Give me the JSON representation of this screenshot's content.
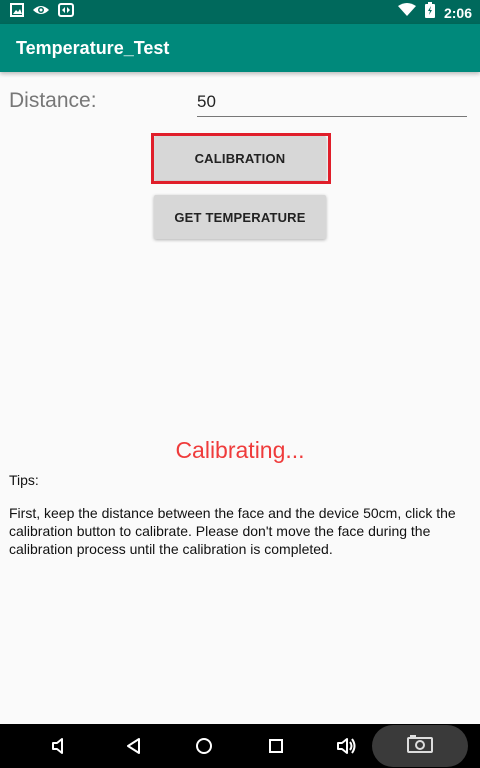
{
  "status_bar": {
    "time": "2:06",
    "icons_left": [
      "image-icon",
      "eye-icon",
      "remote-icon"
    ],
    "icons_right": [
      "wifi-icon",
      "battery-charging-icon"
    ]
  },
  "app_bar": {
    "title": "Temperature_Test"
  },
  "form": {
    "distance_label": "Distance:",
    "distance_value": "50"
  },
  "buttons": {
    "calibration_label": "CALIBRATION",
    "get_temperature_label": "GET TEMPERATURE"
  },
  "status_message": "Calibrating...",
  "tips": {
    "heading": "Tips:",
    "text": "First, keep the distance between the face and the device 50cm, click the calibration button to calibrate. Please don't move the face during the calibration process until the calibration is completed."
  },
  "nav_bar": {
    "buttons": [
      "volume-down-icon",
      "back-icon",
      "home-icon",
      "recents-icon",
      "volume-up-icon",
      "screenshot-camera-icon"
    ]
  },
  "colors": {
    "status_bar": "#00695c",
    "app_bar": "#00897b",
    "button_bg": "#d7d7d7",
    "highlight_border": "#e01e2a",
    "status_message": "#ef3b3b"
  }
}
